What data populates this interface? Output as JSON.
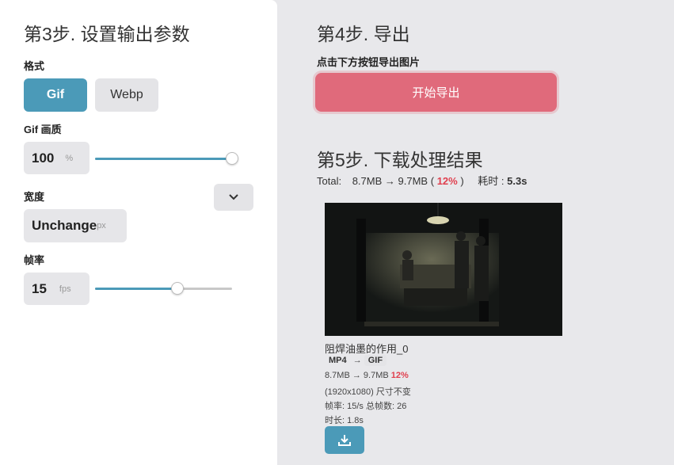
{
  "step3": {
    "title": "第3步. 设置输出参数",
    "format_label": "格式",
    "format_options": [
      "Gif",
      "Webp"
    ],
    "format_selected": "Gif",
    "quality_label": "Gif 画质",
    "quality_value": "100",
    "quality_unit": "%",
    "quality_level_percent": 100,
    "width_label": "宽度",
    "width_value": "Unchange",
    "width_unit": "px",
    "framerate_label": "帧率",
    "framerate_value": "15",
    "framerate_unit": "fps",
    "framerate_level_percent": 60
  },
  "step4": {
    "title": "第4步. 导出",
    "hint": "点击下方按钮导出图片",
    "export_button": "开始导出"
  },
  "step5": {
    "title": "第5步. 下载处理结果",
    "total_label": "Total:",
    "total_from": "8.7MB",
    "total_to": "9.7MB",
    "total_percent": "12%",
    "time_label": "耗时 :",
    "time_value": "5.3s",
    "result": {
      "filename": "阻焊油墨的作用_0",
      "src_format": "MP4",
      "dst_format": "GIF",
      "size_from": "8.7MB",
      "size_to": "9.7MB",
      "size_percent": "12%",
      "dimension_text": "(1920x1080) 尺寸不变",
      "frames_text": "帧率: 15/s 总帧数: 26",
      "duration_text": "时长: 1.8s"
    }
  },
  "colors": {
    "accent": "#4b9ab8",
    "export": "#e06a7b",
    "highlight_red": "#e0404f"
  },
  "icons": {
    "dropdown": "chevron-down-icon",
    "download": "download-icon",
    "arrow": "arrow-right-icon"
  }
}
